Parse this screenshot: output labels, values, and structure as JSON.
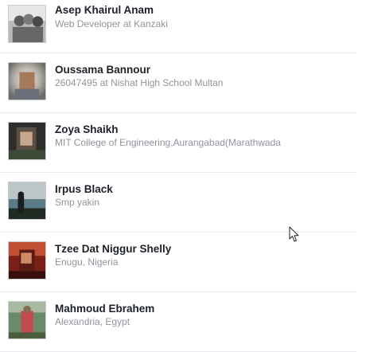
{
  "people": [
    {
      "name": "Asep Khairul Anam",
      "subtitle": "Web Developer at Kanzaki"
    },
    {
      "name": "Oussama Bannour",
      "subtitle": "26047495 at Nishat High School Multan"
    },
    {
      "name": "Zoya Shaikh",
      "subtitle": "MIT College of Engineering,Aurangabad(Marathwada"
    },
    {
      "name": "Irpus Black",
      "subtitle": "Smp yakin"
    },
    {
      "name": "Tzee Dat Niggur Shelly",
      "subtitle": "Enugu, Nigeria"
    },
    {
      "name": "Mahmoud Ebrahem",
      "subtitle": "Alexandria, Egypt"
    }
  ],
  "cursor_icon": "mouse-pointer-icon"
}
